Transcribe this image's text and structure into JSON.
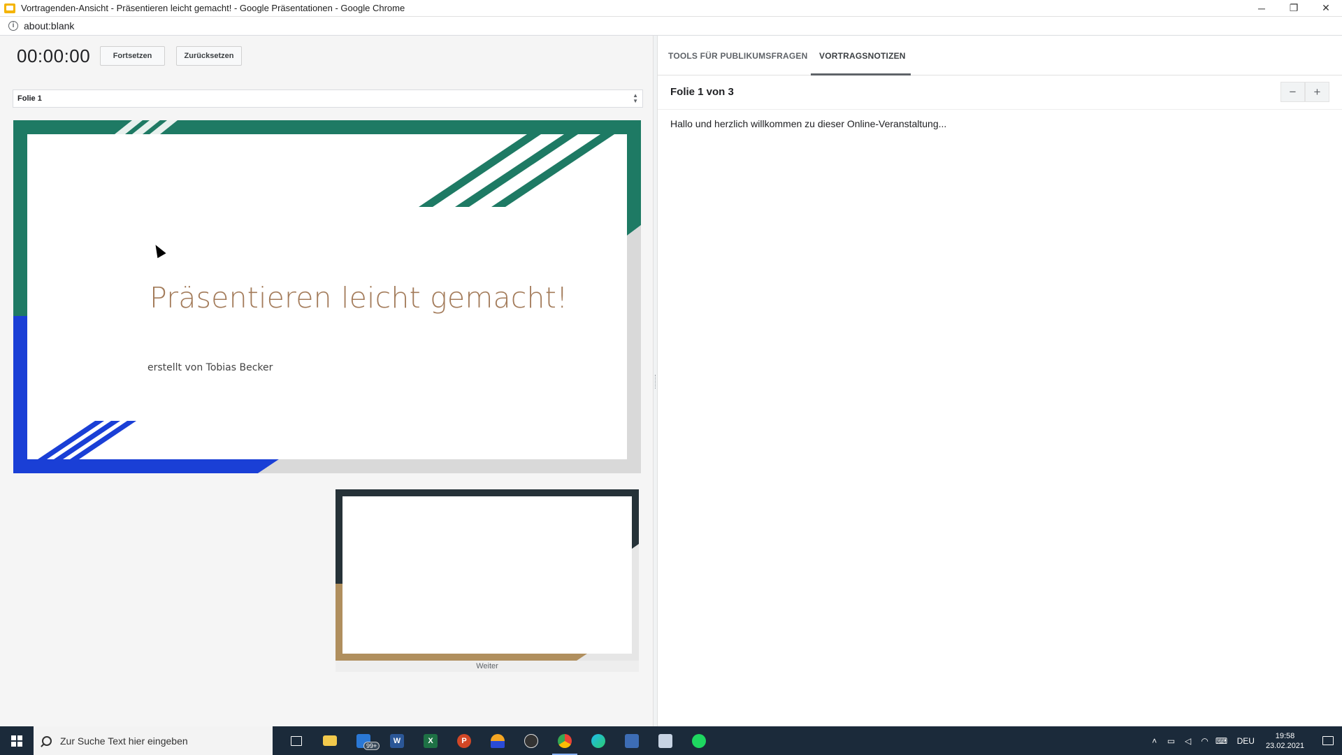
{
  "window": {
    "title": "Vortragenden-Ansicht - Präsentieren leicht gemacht! - Google Präsentationen - Google Chrome",
    "minimize": "─",
    "restore": "❐",
    "close": "✕"
  },
  "address": {
    "info": "i",
    "url": "about:blank"
  },
  "left": {
    "timer": "00:00:00",
    "continue_label": "Fortsetzen",
    "reset_label": "Zurücksetzen",
    "slide_select_value": "Folie 1",
    "current_slide": {
      "title": "Präsentieren leicht gemacht!",
      "subtitle": "erstellt von Tobias Becker"
    },
    "next_label": "Weiter"
  },
  "right": {
    "tab_audience": "TOOLS FÜR PUBLIKUMSFRAGEN",
    "tab_notes": "VORTRAGSNOTIZEN",
    "counter": "Folie 1 von 3",
    "zoom_out": "−",
    "zoom_in": "+",
    "notes_text": "Hallo und herzlich willkommen zu dieser Online-Veranstaltung..."
  },
  "taskbar": {
    "search_placeholder": "Zur Suche Text hier eingeben",
    "mail_badge": "99+",
    "language": "DEU",
    "time": "19:58",
    "date": "23.02.2021",
    "tray_icons": [
      "chevron-up-icon",
      "meet-now-icon",
      "volume-icon",
      "wifi-icon",
      "keyboard-icon"
    ]
  },
  "colors": {
    "slide_green": "#1e7a64",
    "slide_blue": "#1a3fd6",
    "slide_title": "#a37b5a",
    "next_dark": "#263238",
    "next_gold": "#b08f5e",
    "taskbar": "#1b2a3a"
  }
}
